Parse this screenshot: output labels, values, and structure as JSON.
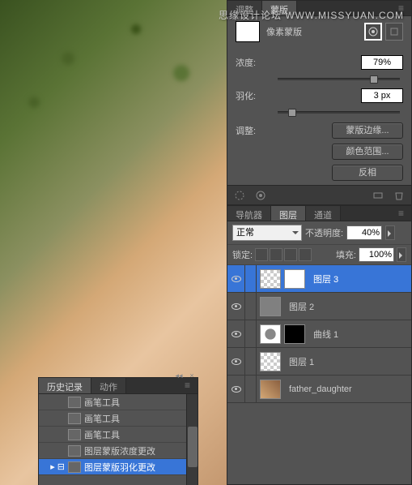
{
  "watermark": "思缘设计论坛  WWW.MISSYUAN.COM",
  "mask_panel": {
    "tabs": [
      "调整",
      "蒙版"
    ],
    "active_tab": 1,
    "mask_type_label": "像素蒙版",
    "density_label": "浓度:",
    "density_value": "79%",
    "density_pct": 79,
    "feather_label": "羽化:",
    "feather_value": "3 px",
    "feather_pct": 12,
    "adjust_label": "调整:",
    "btn_mask_edge": "蒙版边缘...",
    "btn_color_range": "颜色范围...",
    "btn_invert": "反相"
  },
  "layers_panel": {
    "tabs": [
      "导航器",
      "图层",
      "通道"
    ],
    "active_tab": 1,
    "blend_mode": "正常",
    "opacity_label": "不透明度:",
    "opacity_value": "40%",
    "lock_label": "锁定:",
    "fill_label": "填充:",
    "fill_value": "100%",
    "layers": [
      {
        "name": "图层 3",
        "selected": true,
        "thumbs": [
          "checker",
          "white"
        ]
      },
      {
        "name": "图层 2",
        "thumbs": [
          "gray"
        ]
      },
      {
        "name": "曲线 1",
        "thumbs": [
          "circle",
          "black"
        ]
      },
      {
        "name": "图层 1",
        "thumbs": [
          "checker"
        ]
      },
      {
        "name": "father_daughter",
        "thumbs": [
          "photo"
        ]
      }
    ]
  },
  "history_panel": {
    "tabs": [
      "历史记录",
      "动作"
    ],
    "active_tab": 0,
    "items": [
      {
        "name": "画笔工具"
      },
      {
        "name": "画笔工具"
      },
      {
        "name": "画笔工具"
      },
      {
        "name": "图层蒙版浓度更改"
      },
      {
        "name": "图层蒙版羽化更改",
        "selected": true
      }
    ]
  }
}
